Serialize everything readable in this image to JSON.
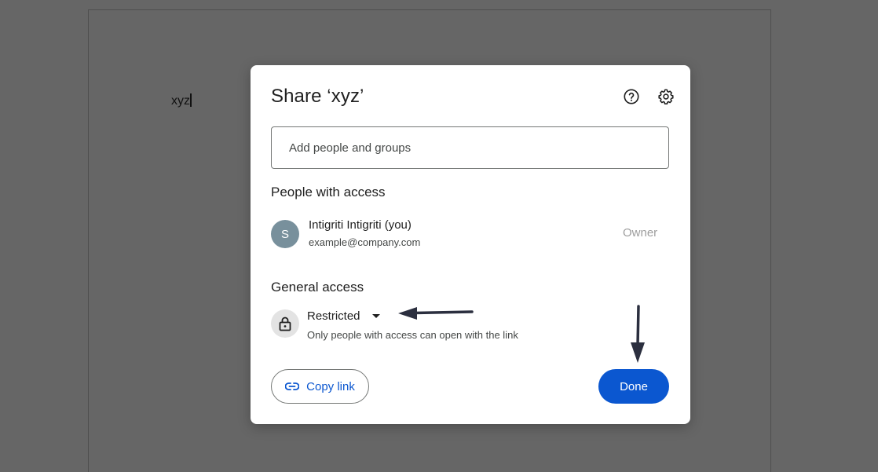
{
  "document": {
    "body_text": "xyz"
  },
  "dialog": {
    "title": "Share ‘xyz’",
    "help_icon": "help-circle-icon",
    "settings_icon": "gear-icon",
    "add_people": {
      "placeholder": "Add people and groups",
      "value": ""
    },
    "people_with_access": {
      "title": "People with access",
      "people": [
        {
          "avatar_initial": "S",
          "avatar_color": "#78909c",
          "name": "Intigriti Intigriti (you)",
          "email": "example@company.com",
          "role": "Owner"
        }
      ]
    },
    "general_access": {
      "title": "General access",
      "icon": "lock-icon",
      "selected": "Restricted",
      "description": "Only people with access can open with the link"
    },
    "buttons": {
      "copy_link": "Copy link",
      "copy_link_icon": "link-icon",
      "done": "Done"
    }
  },
  "colors": {
    "accent": "#0b57d0",
    "overlay": "#666666",
    "annotation_arrow": "#2b2f3f"
  }
}
